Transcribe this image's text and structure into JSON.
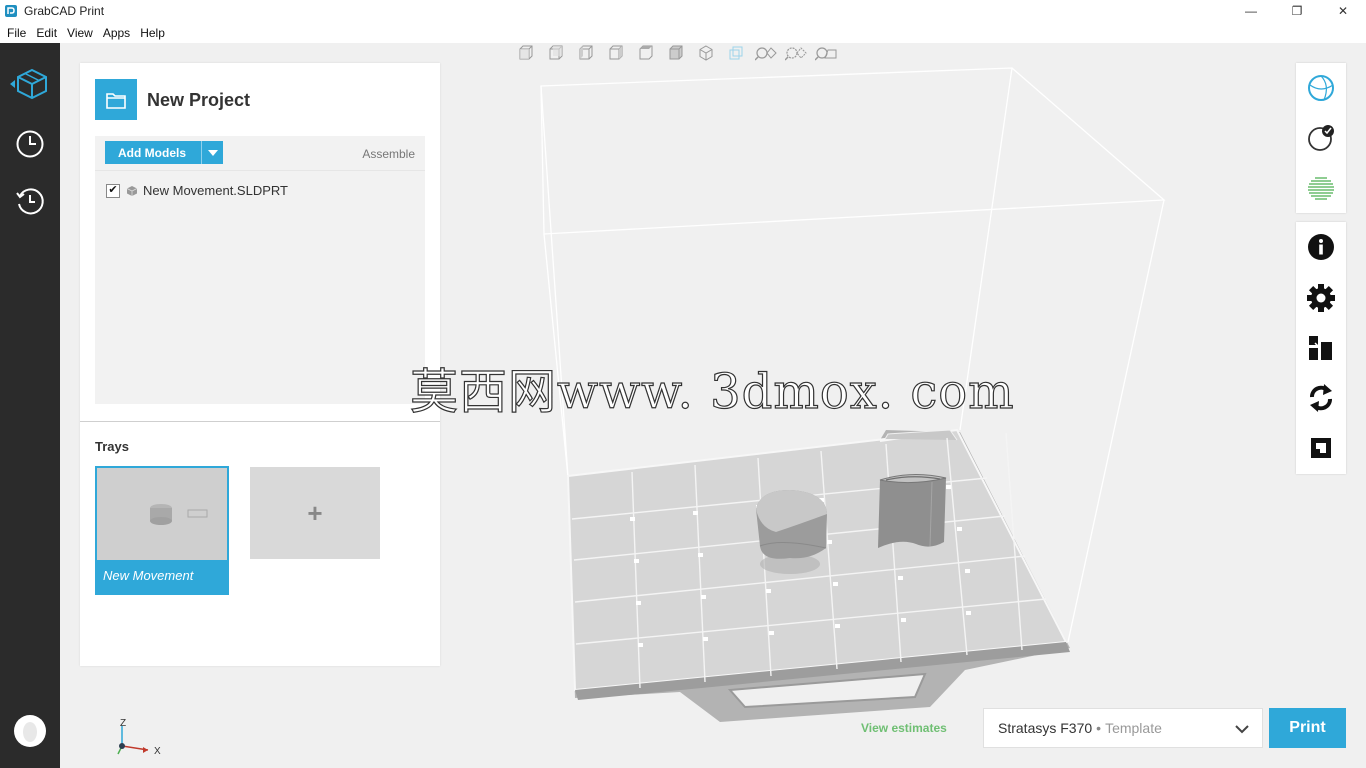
{
  "window": {
    "title": "GrabCAD Print",
    "minimize": "—",
    "maximize": "❐",
    "close": "✕"
  },
  "menu": [
    "File",
    "Edit",
    "View",
    "Apps",
    "Help"
  ],
  "rail": {
    "items": [
      {
        "icon": "model-cube-icon",
        "active": true
      },
      {
        "icon": "clock-icon"
      },
      {
        "icon": "history-clock-icon"
      }
    ],
    "avatar": "user-avatar"
  },
  "project": {
    "title": "New Project",
    "add_models_label": "Add Models",
    "assemble_label": "Assemble",
    "models": [
      {
        "name": "New Movement.SLDPRT",
        "checked": true,
        "check_mark": "✔"
      }
    ],
    "trays_label": "Trays",
    "trays": [
      {
        "name": "New Movement",
        "selected": true
      }
    ],
    "add_tray_label": "+"
  },
  "view_toolbar": [
    "view-front-icon",
    "view-back-icon",
    "view-left-icon",
    "view-right-icon",
    "view-top-icon",
    "view-bottom-icon",
    "view-iso-icon",
    "view-toggle-icon",
    "zoom-fit-icon",
    "zoom-select-icon",
    "zoom-tray-icon"
  ],
  "palette": {
    "group_a": [
      "view-sphere-icon",
      "model-check-icon",
      "slice-layers-icon"
    ],
    "group_b": [
      "info-icon",
      "settings-gear-icon",
      "arrange-icon",
      "rotate-icon",
      "scale-icon"
    ]
  },
  "watermark": "莫西网www. 3dmox. com",
  "axis": {
    "z": "Z",
    "x": "X"
  },
  "bottom": {
    "estimates": "View estimates",
    "printer": "Stratasys F370",
    "separator": "•",
    "template": "Template",
    "print_label": "Print"
  },
  "colors": {
    "accent": "#2fa8d9",
    "rail": "#2b2b2b",
    "estimates": "#6fbf73"
  }
}
